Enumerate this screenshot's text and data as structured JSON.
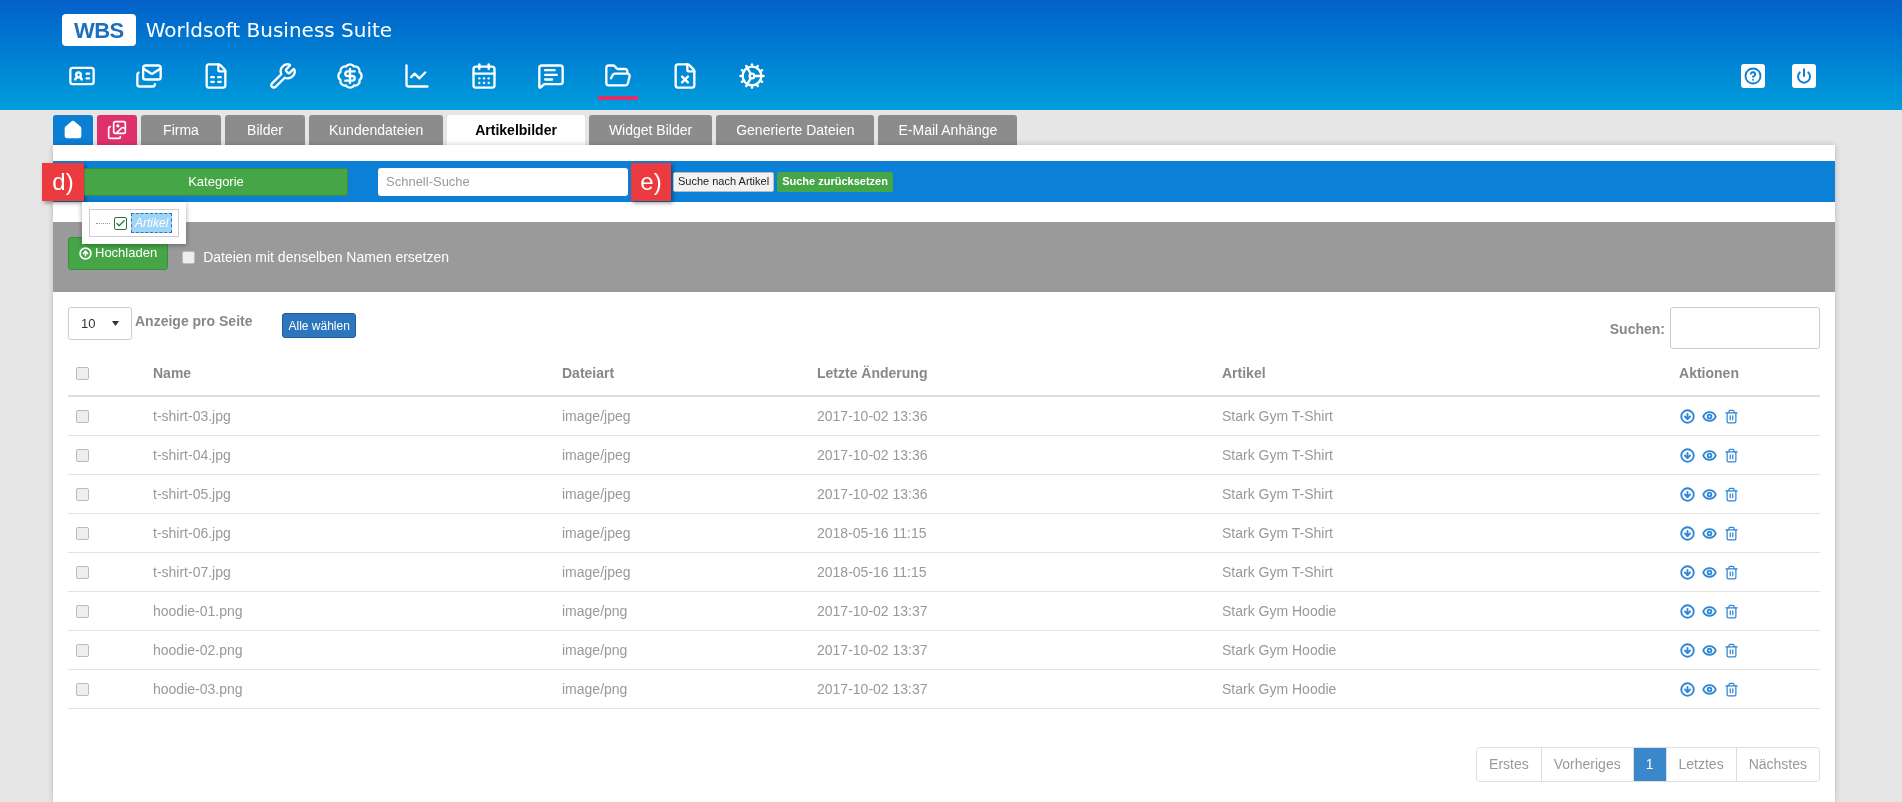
{
  "header": {
    "logo": "WBS",
    "title": "Worldsoft Business Suite"
  },
  "toolbar": [
    {
      "selected": false
    },
    {
      "selected": false
    },
    {
      "selected": false
    },
    {
      "selected": false
    },
    {
      "selected": false
    },
    {
      "selected": false
    },
    {
      "selected": false
    },
    {
      "selected": false
    },
    {
      "selected": true
    },
    {
      "selected": false
    },
    {
      "selected": false
    }
  ],
  "tabs": [
    {
      "kind": "home",
      "selected": false
    },
    {
      "kind": "gallery",
      "selected": false
    },
    {
      "kind": "text",
      "label": "Firma",
      "selected": false
    },
    {
      "kind": "text",
      "label": "Bilder",
      "selected": false
    },
    {
      "kind": "text",
      "label": "Kundendateien",
      "selected": false
    },
    {
      "kind": "text",
      "label": "Artikelbilder",
      "selected": true
    },
    {
      "kind": "text",
      "label": "Widget Bilder",
      "selected": false
    },
    {
      "kind": "text",
      "label": "Generierte Dateien",
      "selected": false
    },
    {
      "kind": "text",
      "label": "E-Mail Anhänge",
      "selected": false
    }
  ],
  "filter_bar": {
    "annotation_left": "d)",
    "category_button": "Kategorie",
    "quick_search": {
      "placeholder": "Schnell-Suche"
    },
    "annotation_right": "e)",
    "search_button": "Suche nach Artikel",
    "reset_button": "Suche zurücksetzen"
  },
  "category_tree": [
    {
      "label": "Artikel",
      "checked": true,
      "selected": true
    }
  ],
  "upload_bar": {
    "upload_button": "Hochladen",
    "replace_option": {
      "label": "Dateien mit denselben Namen ersetzen",
      "checked": false
    }
  },
  "table_controls": {
    "page_size": "10",
    "page_size_label": "Anzeige pro Seite",
    "select_all_button": "Alle wählen",
    "search_label": "Suchen:"
  },
  "table": {
    "select_all_checked": false,
    "columns": [
      "Name",
      "Dateiart",
      "Letzte Änderung",
      "Artikel",
      "Aktionen"
    ],
    "rows": [
      {
        "name": "t-shirt-03.jpg",
        "type": "image/jpeg",
        "modified": "2017-10-02 13:36",
        "article": "Stark Gym T-Shirt",
        "checked": false
      },
      {
        "name": "t-shirt-04.jpg",
        "type": "image/jpeg",
        "modified": "2017-10-02 13:36",
        "article": "Stark Gym T-Shirt",
        "checked": false
      },
      {
        "name": "t-shirt-05.jpg",
        "type": "image/jpeg",
        "modified": "2017-10-02 13:36",
        "article": "Stark Gym T-Shirt",
        "checked": false
      },
      {
        "name": "t-shirt-06.jpg",
        "type": "image/jpeg",
        "modified": "2018-05-16 11:15",
        "article": "Stark Gym T-Shirt",
        "checked": false
      },
      {
        "name": "t-shirt-07.jpg",
        "type": "image/jpeg",
        "modified": "2018-05-16 11:15",
        "article": "Stark Gym T-Shirt",
        "checked": false
      },
      {
        "name": "hoodie-01.png",
        "type": "image/png",
        "modified": "2017-10-02 13:37",
        "article": "Stark Gym Hoodie",
        "checked": false
      },
      {
        "name": "hoodie-02.png",
        "type": "image/png",
        "modified": "2017-10-02 13:37",
        "article": "Stark Gym Hoodie",
        "checked": false
      },
      {
        "name": "hoodie-03.png",
        "type": "image/png",
        "modified": "2017-10-02 13:37",
        "article": "Stark Gym Hoodie",
        "checked": false
      }
    ]
  },
  "pagination": [
    {
      "label": "Erstes",
      "selected": false
    },
    {
      "label": "Vorheriges",
      "selected": false
    },
    {
      "label": "1",
      "selected": true
    },
    {
      "label": "Letztes",
      "selected": false
    },
    {
      "label": "Nächstes",
      "selected": false
    }
  ]
}
